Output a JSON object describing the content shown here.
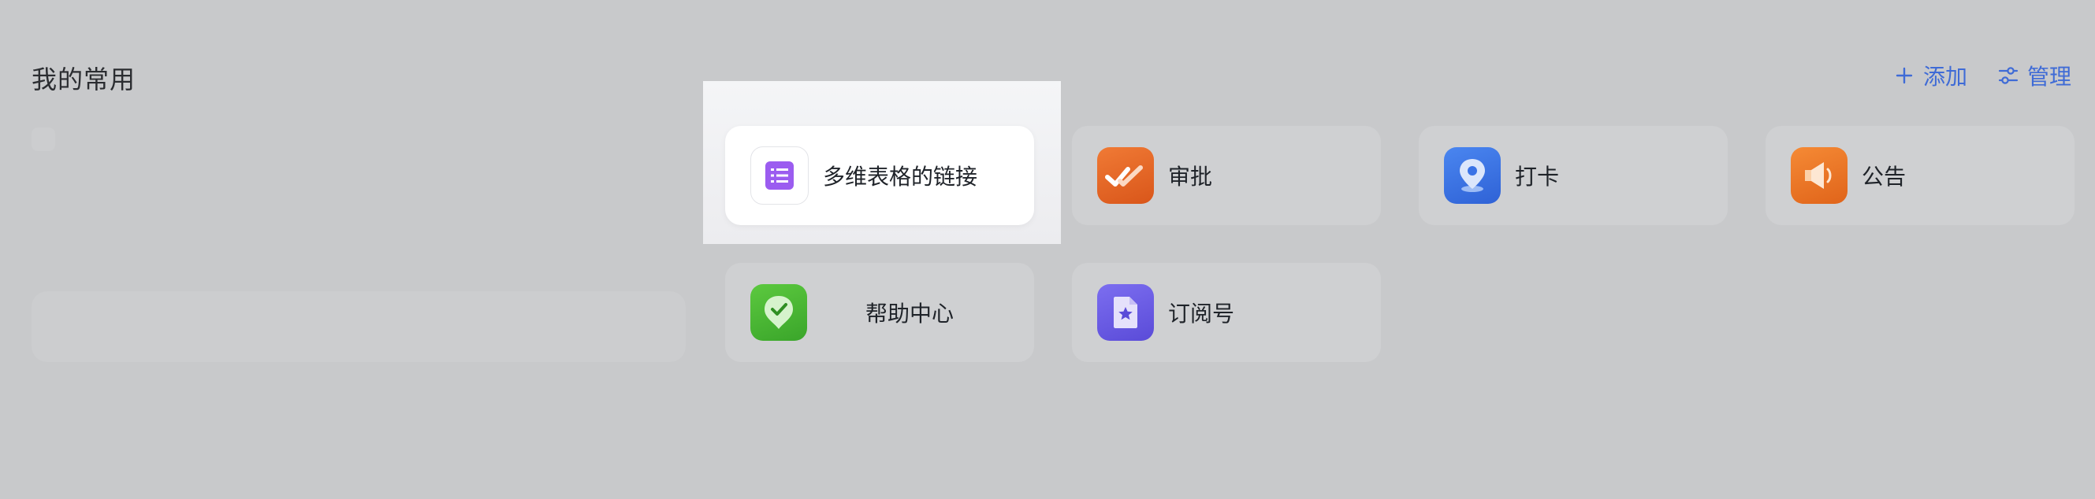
{
  "section": {
    "title": "我的常用"
  },
  "header_actions": {
    "add_label": "添加",
    "manage_label": "管理"
  },
  "apps": [
    {
      "label": "多维表格的链接",
      "icon": "bitable-icon",
      "color": "#9b5cf0"
    },
    {
      "label": "审批",
      "icon": "approval-icon",
      "color": "#e8631e"
    },
    {
      "label": "打卡",
      "icon": "attendance-icon",
      "color": "#3a73e6"
    },
    {
      "label": "公告",
      "icon": "announcement-icon",
      "color": "#ee7620"
    },
    {
      "label": "帮助中心",
      "icon": "help-center-icon",
      "color": "#4db935"
    },
    {
      "label": "订阅号",
      "icon": "subscription-icon",
      "color": "#6b5ce8"
    }
  ],
  "colors": {
    "accent": "#3f6bd6",
    "background": "#c8c9cb"
  }
}
